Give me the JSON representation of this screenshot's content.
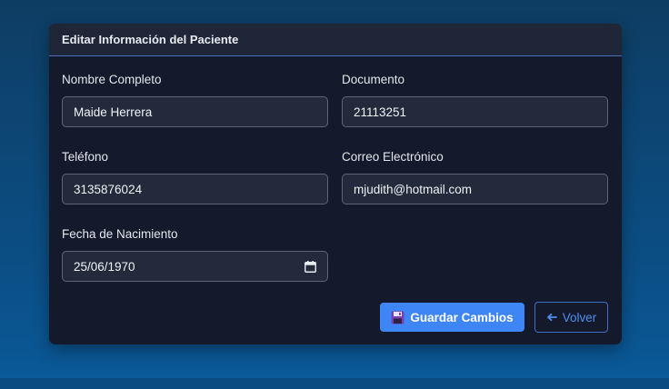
{
  "form": {
    "title": "Editar Información del Paciente",
    "fields": {
      "nombre": {
        "label": "Nombre Completo",
        "value": "Maide Herrera"
      },
      "documento": {
        "label": "Documento",
        "value": "21113251"
      },
      "telefono": {
        "label": "Teléfono",
        "value": "3135876024"
      },
      "correo": {
        "label": "Correo Electrónico",
        "value": "mjudith@hotmail.com"
      },
      "fecha": {
        "label": "Fecha de Nacimiento",
        "value": "25/06/1970"
      }
    },
    "buttons": {
      "save_label": "Guardar Cambios",
      "back_label": "Volver"
    }
  },
  "colors": {
    "primary": "#3e86f5",
    "card_bg": "#141a2b",
    "header_bg": "#1f2637",
    "input_bg": "#222a3b"
  },
  "icons": {
    "save": "floppy-disk-icon",
    "back": "arrow-left-icon",
    "date": "calendar-icon"
  }
}
